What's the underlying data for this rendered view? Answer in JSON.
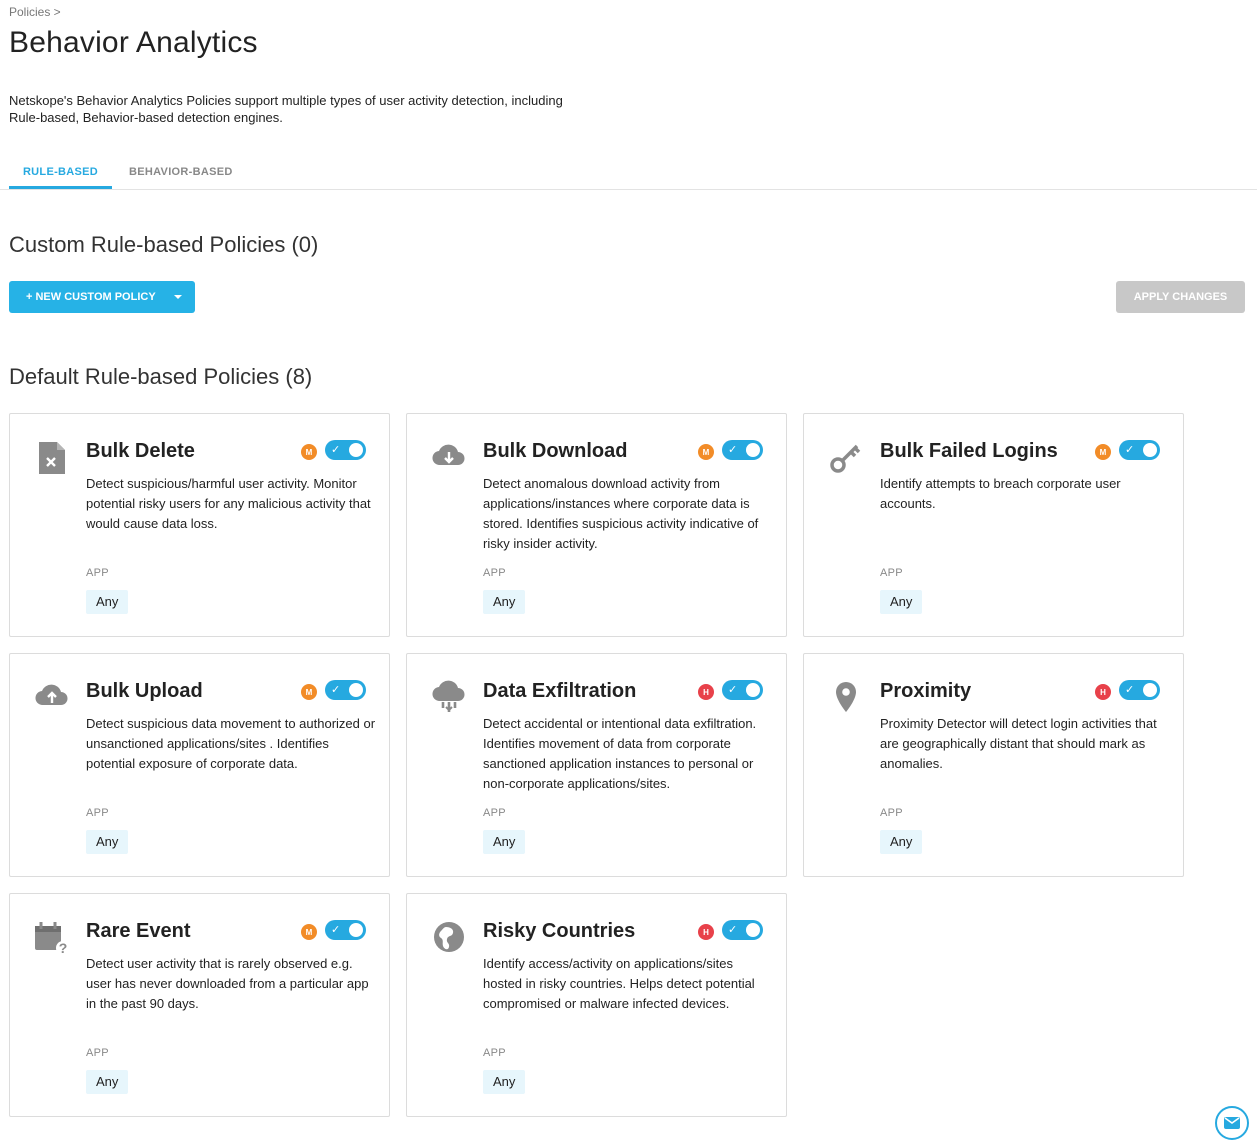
{
  "breadcrumb": "Policies >",
  "page_title": "Behavior Analytics",
  "description": "Netskope's Behavior Analytics Policies support multiple types of user activity detection, including Rule-based, Behavior-based detection engines.",
  "tabs": [
    {
      "label": "RULE-BASED",
      "active": true
    },
    {
      "label": "BEHAVIOR-BASED",
      "active": false
    }
  ],
  "custom_section": {
    "title": "Custom Rule-based Policies (0)",
    "new_button": "+ NEW CUSTOM POLICY",
    "apply_button": "APPLY CHANGES"
  },
  "default_section": {
    "title": "Default Rule-based Policies (8)"
  },
  "colors": {
    "accent": "#26a9e0",
    "medium": "#f28c28",
    "high": "#e8414a",
    "chip": "#e7f6fc"
  },
  "policies": [
    {
      "title": "Bulk Delete",
      "icon": "file-delete-icon",
      "severity": "M",
      "enabled": true,
      "description": "Detect suspicious/harmful user activity. Monitor potential risky users for any malicious activity that would cause data loss.",
      "app_label": "APP",
      "app_value": "Any"
    },
    {
      "title": "Bulk Download",
      "icon": "cloud-download-icon",
      "severity": "M",
      "enabled": true,
      "description": "Detect anomalous download activity from applications/instances where corporate data is stored. Identifies suspicious activity indicative of risky insider activity.",
      "app_label": "APP",
      "app_value": "Any"
    },
    {
      "title": "Bulk Failed Logins",
      "icon": "key-icon",
      "severity": "M",
      "enabled": true,
      "description": "Identify attempts to breach corporate user accounts.",
      "app_label": "APP",
      "app_value": "Any"
    },
    {
      "title": "Bulk Upload",
      "icon": "cloud-upload-icon",
      "severity": "M",
      "enabled": true,
      "description": "Detect suspicious data movement to authorized or unsanctioned applications/sites . Identifies potential exposure of corporate data.",
      "app_label": "APP",
      "app_value": "Any"
    },
    {
      "title": "Data Exfiltration",
      "icon": "cloud-exfiltration-icon",
      "severity": "H",
      "enabled": true,
      "description": "Detect accidental or intentional data exfiltration. Identifies movement of data from corporate sanctioned application instances to personal or non-corporate applications/sites.",
      "app_label": "APP",
      "app_value": "Any"
    },
    {
      "title": "Proximity",
      "icon": "location-pin-icon",
      "severity": "H",
      "enabled": true,
      "description": "Proximity Detector will detect login activities that are geographically distant that should mark as anomalies.",
      "app_label": "APP",
      "app_value": "Any"
    },
    {
      "title": "Rare Event",
      "icon": "calendar-question-icon",
      "severity": "M",
      "enabled": true,
      "description": "Detect user activity that is rarely observed e.g. user has never downloaded from a particular app in the past 90 days.",
      "app_label": "APP",
      "app_value": "Any"
    },
    {
      "title": "Risky Countries",
      "icon": "globe-icon",
      "severity": "H",
      "enabled": true,
      "description": "Identify access/activity on applications/sites hosted in risky countries. Helps detect potential compromised or malware infected devices.",
      "app_label": "APP",
      "app_value": "Any"
    }
  ]
}
